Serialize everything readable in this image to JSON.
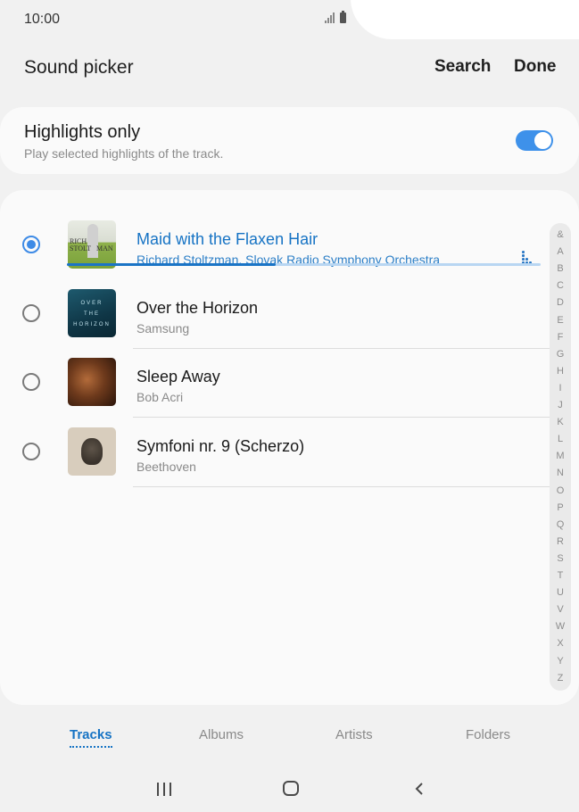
{
  "status_bar": {
    "time": "10:00"
  },
  "app_bar": {
    "title": "Sound picker",
    "search_label": "Search",
    "done_label": "Done"
  },
  "highlights": {
    "title": "Highlights only",
    "subtitle": "Play selected highlights of the track.",
    "enabled": true,
    "accent_color": "#3e91ea"
  },
  "tracks": [
    {
      "title": "Maid with the Flaxen Hair",
      "artist": "Richard Stoltzman, Slovak Radio Symphony Orchestra",
      "selected": true,
      "art": "album-art-richard-stoltzman",
      "art_text": "RICH STOLT MAN"
    },
    {
      "title": "Over the Horizon",
      "artist": "Samsung",
      "selected": false,
      "art": "album-art-over-the-horizon",
      "art_text": "OVER THE HORIZON"
    },
    {
      "title": "Sleep Away",
      "artist": "Bob Acri",
      "selected": false,
      "art": "album-art-sleep-away"
    },
    {
      "title": "Symfoni nr. 9 (Scherzo)",
      "artist": "Beethoven",
      "selected": false,
      "art": "album-art-beethoven"
    }
  ],
  "playback_progress": 0.44,
  "index_letters": [
    "&",
    "A",
    "B",
    "C",
    "D",
    "E",
    "F",
    "G",
    "H",
    "I",
    "J",
    "K",
    "L",
    "M",
    "N",
    "O",
    "P",
    "Q",
    "R",
    "S",
    "T",
    "U",
    "V",
    "W",
    "X",
    "Y",
    "Z"
  ],
  "tabs": [
    {
      "label": "Tracks",
      "active": true
    },
    {
      "label": "Albums",
      "active": false
    },
    {
      "label": "Artists",
      "active": false
    },
    {
      "label": "Folders",
      "active": false
    }
  ],
  "nav_bar": {
    "icons": [
      "recents-icon",
      "home-icon",
      "back-icon"
    ]
  },
  "colors": {
    "selected_text": "#1673c4",
    "progress": "#1a74c6"
  }
}
